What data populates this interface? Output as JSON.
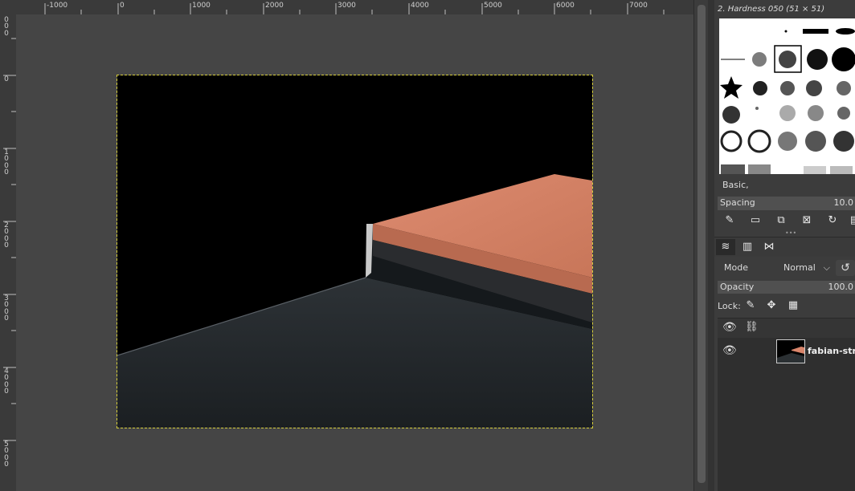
{
  "rulers": {
    "top_labels": [
      "-1000",
      "0",
      "1000",
      "2000",
      "3000",
      "4000",
      "5000",
      "6000",
      "7000"
    ],
    "left_labels": [
      "0\n0\n0",
      "0",
      "1\n0\n0\n0",
      "2\n0\n0\n0",
      "3\n0\n0\n0",
      "4\n0\n0\n0",
      "5\n0\n0\n0"
    ]
  },
  "brushes": {
    "title": "2. Hardness 050 (51 × 51)",
    "tag_filter": "Basic,",
    "spacing_label": "Spacing",
    "spacing_value": "10.0"
  },
  "layers": {
    "mode_label": "Mode",
    "mode_value": "Normal",
    "opacity_label": "Opacity",
    "opacity_value": "100.0",
    "lock_label": "Lock:",
    "items": [
      {
        "name": "fabian-stro",
        "visible": true
      }
    ]
  },
  "colors": {
    "canvas_bg": "#454545",
    "panel_bg": "#3c3c3c",
    "selection_border": "#d8cf3c",
    "box_orange": "#d97f66"
  }
}
